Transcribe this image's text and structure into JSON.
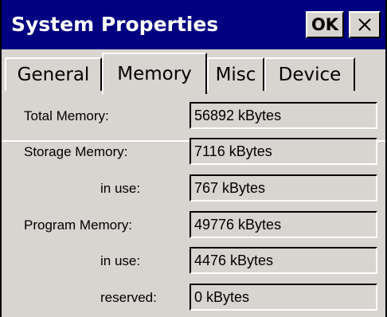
{
  "window": {
    "title": "System Properties",
    "ok_label": "OK",
    "close_icon": "close-icon"
  },
  "tabs": [
    {
      "label": "General",
      "active": false
    },
    {
      "label": "Memory",
      "active": true
    },
    {
      "label": "Misc",
      "active": false
    },
    {
      "label": "Device",
      "active": false
    }
  ],
  "memory": {
    "rows": [
      {
        "label": "Total Memory:",
        "value": "56892 kBytes"
      },
      {
        "label": "Storage Memory:",
        "value": "7116 kBytes"
      },
      {
        "label": "in use:",
        "value": "767 kBytes"
      },
      {
        "label": "Program Memory:",
        "value": "49776 kBytes"
      },
      {
        "label": "in use:",
        "value": "4476 kBytes"
      },
      {
        "label": "reserved:",
        "value": "0 kBytes"
      }
    ]
  }
}
